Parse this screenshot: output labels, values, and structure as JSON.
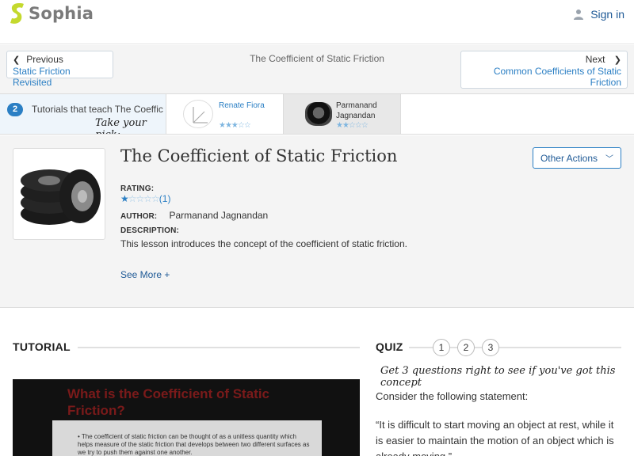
{
  "header": {
    "brand": "Sophia",
    "signin": "Sign in"
  },
  "pager": {
    "prev_label": "Previous",
    "prev_link": "Static Friction Revisited",
    "center_title": "The Coefficient of Static Friction",
    "next_label": "Next",
    "next_link": "Common Coefficients of Static Friction"
  },
  "tutorials": {
    "count": "2",
    "text": "Tutorials that teach The Coeffic",
    "pick": "Take your pick:",
    "cards": [
      {
        "name": "Renate Fiora",
        "stars": "★★★☆☆"
      },
      {
        "name": "Parmanand Jagnandan",
        "stars": "★★☆☆☆"
      }
    ]
  },
  "lesson": {
    "title": "The Coefficient of Static Friction",
    "actions": "Other Actions",
    "rating_label": "RATING:",
    "rating_stars_on": "★",
    "rating_stars_off": "☆☆☆☆",
    "rating_count": "(1)",
    "author_label": "AUTHOR:",
    "author": "Parmanand Jagnandan",
    "desc_label": "DESCRIPTION:",
    "desc": "This lesson introduces the concept of the coefficient of static friction.",
    "see_more": "See More +"
  },
  "tutorial": {
    "heading": "TUTORIAL",
    "video_title_1": "What is the Coefficient of Static",
    "video_title_2": "Friction?",
    "slide_text": "• The coefficient of static friction can be thought of as a unitless quantity which helps measure of the static friction that develops between two different surfaces as we try to push them against one another."
  },
  "quiz": {
    "heading": "QUIZ",
    "numbers": [
      "1",
      "2",
      "3"
    ],
    "tagline": "Get 3 questions right to see if you've got this concept",
    "prompt": "Consider the following statement:",
    "quote": "“It is difficult to start moving an object at rest, while it is easier to maintain the motion of an object which is already moving.”"
  },
  "colors": {
    "brand_green": "#c4d92e",
    "link_blue": "#2b7fc4",
    "dark_blue": "#1f5a96"
  }
}
